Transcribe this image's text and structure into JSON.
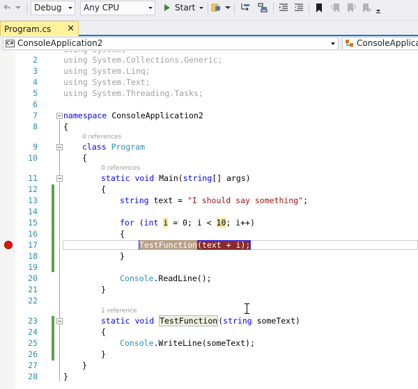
{
  "toolbar": {
    "config": "Debug",
    "platform": "Any CPU",
    "start_label": "Start"
  },
  "tab": {
    "title": "Program.cs",
    "close": "✕"
  },
  "navbar": {
    "project": "ConsoleApplication2",
    "class": "ConsoleApplicati"
  },
  "editor": {
    "line_numbers": [
      "2",
      "3",
      "4",
      "5",
      "6",
      "7",
      "8",
      "9",
      "10",
      "11",
      "12",
      "13",
      "14",
      "15",
      "16",
      "17",
      "18",
      "19",
      "20",
      "21",
      "22",
      "23",
      "24",
      "25",
      "26",
      "27",
      "28"
    ],
    "codelens": {
      "program": "0 references",
      "main": "0 references",
      "testfunction": "1 reference"
    },
    "lines": {
      "l2": "using System.Collections.Generic;",
      "l3": "using System.Linq;",
      "l4": "using System.Text;",
      "l5": "using System.Threading.Tasks;",
      "l7_kw": "namespace",
      "l7_rest": " ConsoleApplication2",
      "brace_open": "{",
      "brace_close": "}",
      "l9_kw": "class",
      "l9_name": "Program",
      "l11_kw1": "static",
      "l11_kw2": "void",
      "l11_a": " Main(",
      "l11_kw3": "string",
      "l11_b": "[] args)",
      "l13_kw": "string",
      "l13_a": " text = ",
      "l13_str": "\"I should say something\"",
      "l13_b": ";",
      "l15_kw1": "for",
      "l15_a": " (",
      "l15_kw2": "int",
      "l15_b": " ",
      "l15_i": "i",
      "l15_c": " = 0; i < ",
      "l15_ten": "10",
      "l15_d": "; i++)",
      "l17_name": "TestFunction",
      "l17_rest": "(text + i);",
      "l20_ty": "Console",
      "l20_rest": ".ReadLine();",
      "l23_kw1": "static",
      "l23_kw2": "void",
      "l23_name": "TestFunction",
      "l23_a": "(",
      "l23_kw3": "string",
      "l23_b": " someText)",
      "l25_ty": "Console",
      "l25_rest": ".WriteLine(someText);"
    }
  }
}
